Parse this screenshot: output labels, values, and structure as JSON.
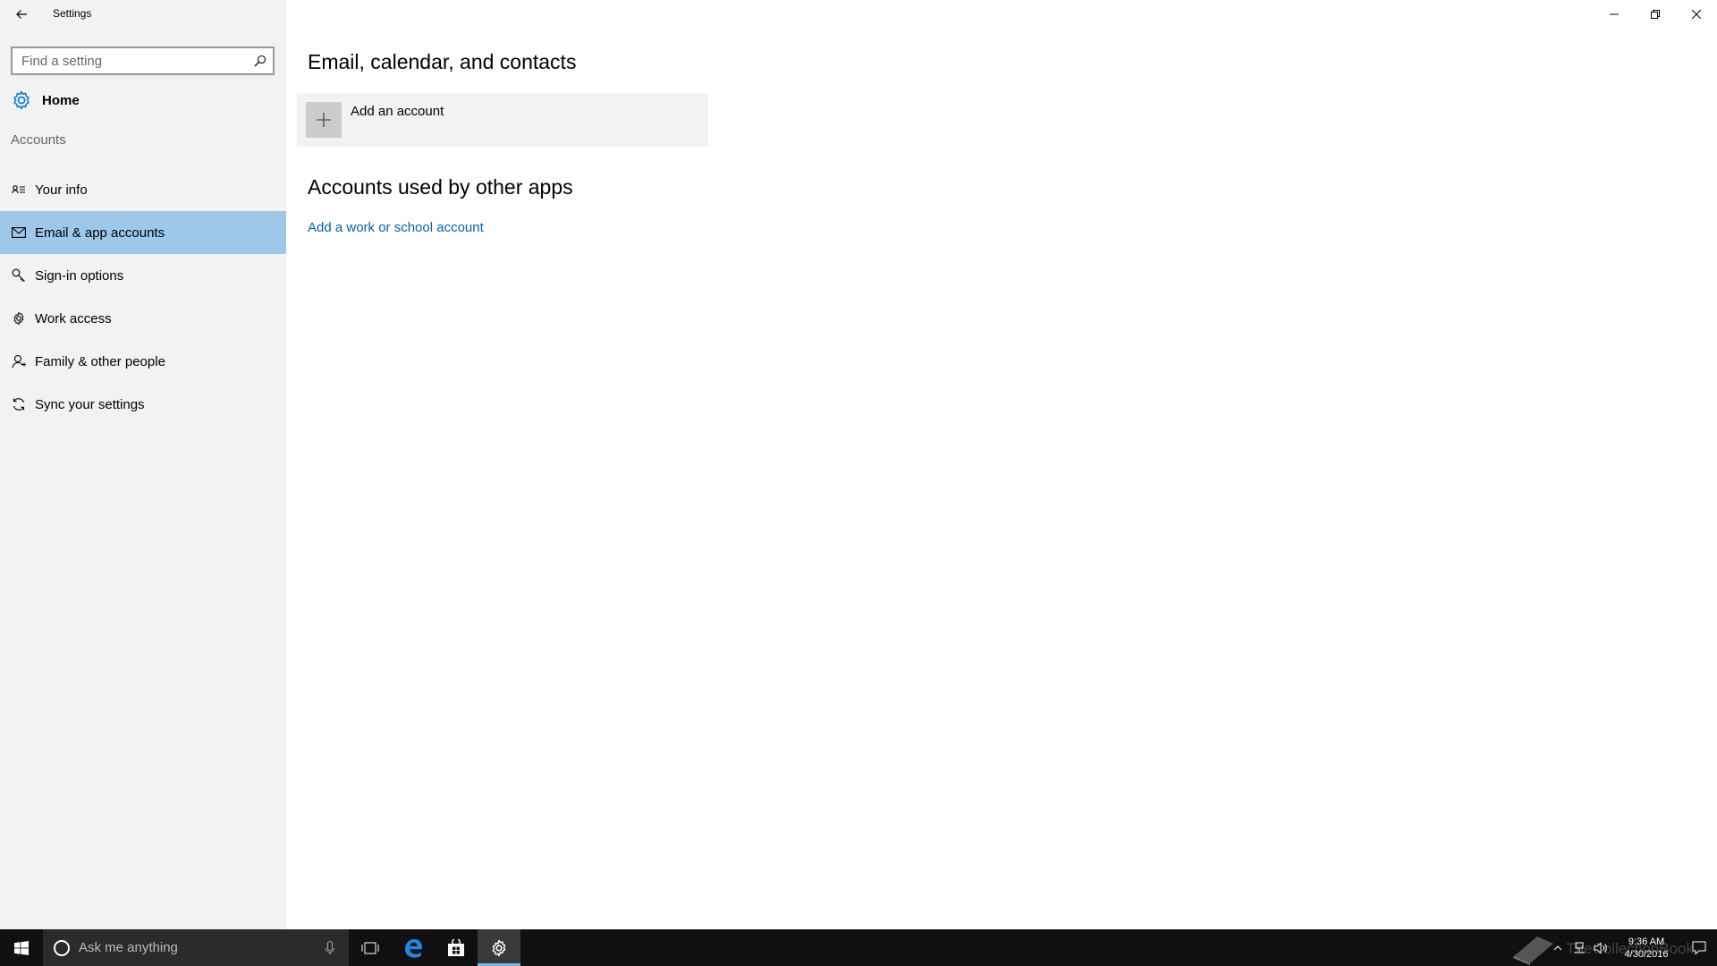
{
  "window": {
    "title": "Settings"
  },
  "sidebar": {
    "search_placeholder": "Find a setting",
    "home_label": "Home",
    "section_label": "Accounts",
    "items": [
      {
        "label": "Your info",
        "icon": "contact-card-icon",
        "active": false
      },
      {
        "label": "Email & app accounts",
        "icon": "mail-icon",
        "active": true
      },
      {
        "label": "Sign-in options",
        "icon": "key-icon",
        "active": false
      },
      {
        "label": "Work access",
        "icon": "briefcase-gear-icon",
        "active": false
      },
      {
        "label": "Family & other people",
        "icon": "person-icon",
        "active": false
      },
      {
        "label": "Sync your settings",
        "icon": "sync-icon",
        "active": false
      }
    ]
  },
  "main": {
    "heading_email": "Email, calendar, and contacts",
    "add_account_label": "Add an account",
    "heading_other_apps": "Accounts used by other apps",
    "work_school_link": "Add a work or school account"
  },
  "taskbar": {
    "search_placeholder": "Ask me anything",
    "watermark": "TheCollectionBook",
    "time": "9:36 AM",
    "date": "4/30/2016"
  },
  "colors": {
    "sidebar_bg": "#f2f2f2",
    "active_item": "#9dc8ea",
    "link": "#0063b1",
    "taskbar_bg": "#101010",
    "accent": "#0078d7"
  }
}
